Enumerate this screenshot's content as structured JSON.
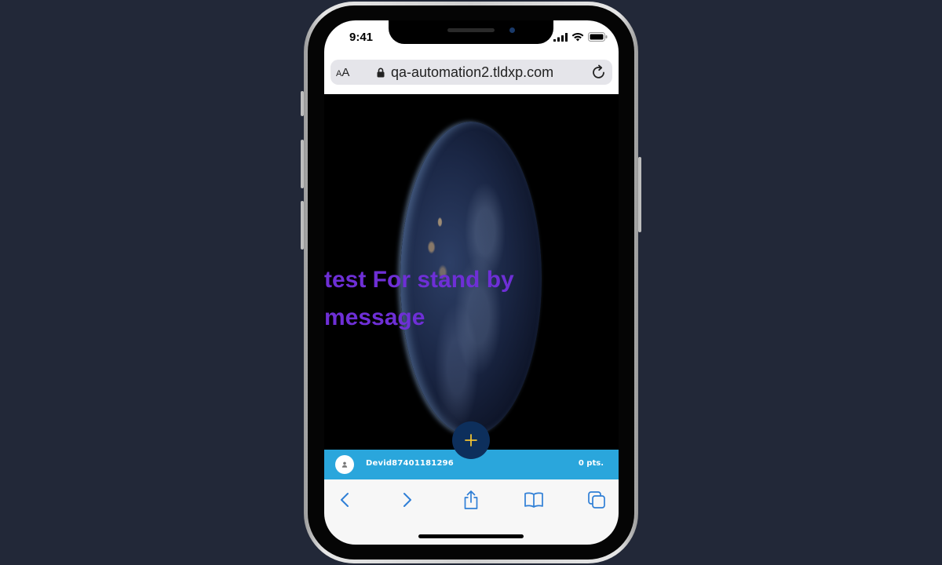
{
  "status_bar": {
    "time": "9:41"
  },
  "browser": {
    "text_size_small": "A",
    "text_size_large": "A",
    "url": "qa-automation2.tldxp.com"
  },
  "content": {
    "standby_message": "test For stand by message"
  },
  "user_bar": {
    "username": "Devid87401181296",
    "points": "0 pts."
  },
  "fab": {
    "label": "+"
  },
  "colors": {
    "background": "#222838",
    "message_text": "#6e2fd6",
    "user_bar": "#2aa6dc",
    "fab_background": "#0d2f5c",
    "fab_plus": "#f2c230",
    "toolbar_icons": "#2f7fd6"
  },
  "toolbar": {
    "icons": [
      "back-icon",
      "forward-icon",
      "share-icon",
      "bookmarks-icon",
      "tabs-icon"
    ]
  }
}
